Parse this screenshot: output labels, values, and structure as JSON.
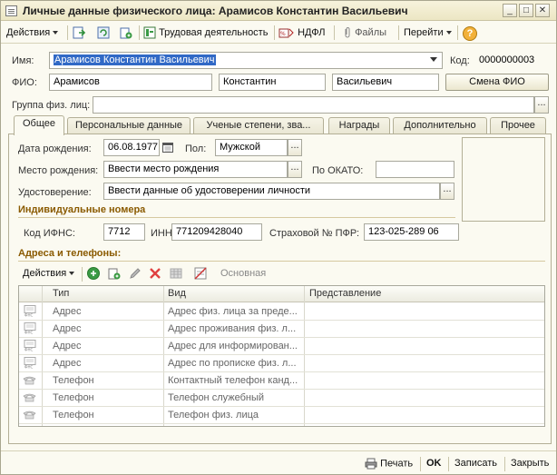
{
  "window": {
    "title": "Личные данные физического лица: Арамисов Константин Васильевич",
    "minimize": "_",
    "maximize": "□",
    "close": "✕"
  },
  "toolbar": {
    "actions_label": "Действия",
    "work_label": "Трудовая деятельность",
    "ndfl_label": "НДФЛ",
    "files_label": "Файлы",
    "goto_label": "Перейти",
    "help_label": "?"
  },
  "form": {
    "name_label": "Имя:",
    "name_value": "Арамисов Константин Васильевич",
    "code_label": "Код:",
    "code_value": "0000000003",
    "fio_label": "ФИО:",
    "last_name": "Арамисов",
    "first_name": "Константин",
    "middle_name": "Васильевич",
    "change_fio_button": "Смена ФИО",
    "group_label": "Группа физ. лиц:",
    "group_value": ""
  },
  "tabs": [
    {
      "label": "Общее",
      "active": true
    },
    {
      "label": "Персональные данные",
      "active": false
    },
    {
      "label": "Ученые степени, зва...",
      "active": false
    },
    {
      "label": "Награды",
      "active": false
    },
    {
      "label": "Дополнительно",
      "active": false
    },
    {
      "label": "Прочее",
      "active": false
    }
  ],
  "general": {
    "birth_date_label": "Дата рождения:",
    "birth_date": "06.08.1977",
    "sex_label": "Пол:",
    "sex_value": "Мужской",
    "birth_place_label": "Место рождения:",
    "birth_place_value": "Ввести место рождения",
    "okato_label": "По ОКАТО:",
    "okato_value": "",
    "id_label": "Удостоверение:",
    "id_value": "Ввести данные об удостоверении личности",
    "ids_section": "Индивидуальные номера",
    "ifns_label": "Код ИФНС:",
    "ifns_value": "7712",
    "inn_label": "ИНН:",
    "inn_value": "771209428040",
    "pfr_label": "Страховой № ПФР:",
    "pfr_value": "123-025-289 06",
    "address_section": "Адреса и телефоны:",
    "addr_actions_label": "Действия",
    "addr_main_label": "Основная"
  },
  "address_table": {
    "columns": [
      "Тип",
      "Вид",
      "Представление"
    ],
    "rows": [
      {
        "type": "Адрес",
        "kind": "Адрес физ. лица за преде...",
        "repr": "",
        "icon": "fns"
      },
      {
        "type": "Адрес",
        "kind": "Адрес проживания физ. л...",
        "repr": "",
        "icon": "fns"
      },
      {
        "type": "Адрес",
        "kind": "Адрес для информирован...",
        "repr": "",
        "icon": "fns"
      },
      {
        "type": "Адрес",
        "kind": "Адрес по прописке физ. л...",
        "repr": "",
        "icon": "fns"
      },
      {
        "type": "Телефон",
        "kind": "Контактный телефон канд...",
        "repr": "",
        "icon": "phone"
      },
      {
        "type": "Телефон",
        "kind": "Телефон служебный",
        "repr": "",
        "icon": "phone"
      },
      {
        "type": "Телефон",
        "kind": "Телефон физ. лица",
        "repr": "",
        "icon": "phone"
      }
    ]
  },
  "bottom": {
    "print_label": "Печать",
    "ok_label": "OK",
    "save_label": "Записать",
    "close_label": "Закрыть"
  },
  "colors": {
    "selection": "#3169c6",
    "section_text": "#8a5a00",
    "window_bg": "#fbfaf1"
  }
}
